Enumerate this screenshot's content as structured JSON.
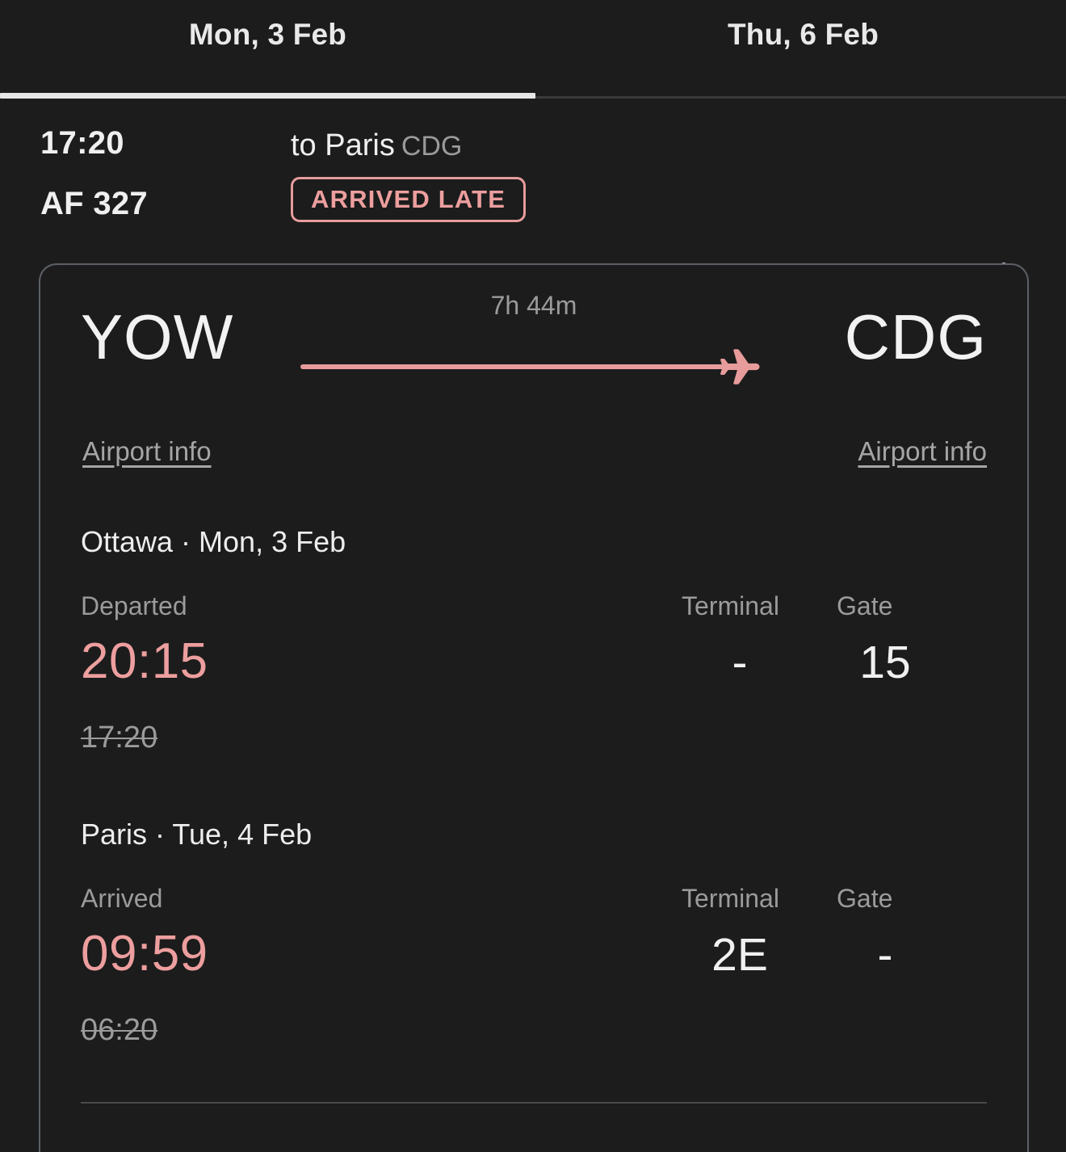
{
  "colors": {
    "background": "#1c1c1c",
    "accent_salmon": "#ed9e9e",
    "text_primary": "#f0f0f0",
    "text_muted": "#9b9b9b",
    "card_border": "#5c6066",
    "tab_indicator": "#e6e6e6"
  },
  "tabs": [
    {
      "label": "Mon, 3 Feb",
      "active": true
    },
    {
      "label": "Thu, 6 Feb",
      "active": false
    }
  ],
  "flight_header": {
    "scheduled_time": "17:20",
    "flight_number": "AF 327",
    "destination_prefix": "to Paris",
    "destination_code": "CDG",
    "status_badge": "ARRIVED LATE",
    "collapse_icon": "chevron-up-icon"
  },
  "route": {
    "origin_code": "YOW",
    "destination_code": "CDG",
    "duration": "7h 44m",
    "plane_icon": "airplane-icon",
    "origin_airport_info_label": "Airport info",
    "destination_airport_info_label": "Airport info"
  },
  "departure": {
    "title": "Ottawa · Mon, 3 Feb",
    "status_label": "Departed",
    "actual_time": "20:15",
    "scheduled_time": "17:20",
    "terminal_label": "Terminal",
    "terminal_value": "-",
    "gate_label": "Gate",
    "gate_value": "15"
  },
  "arrival": {
    "title": "Paris · Tue, 4 Feb",
    "status_label": "Arrived",
    "actual_time": "09:59",
    "scheduled_time": "06:20",
    "terminal_label": "Terminal",
    "terminal_value": "2E",
    "gate_label": "Gate",
    "gate_value": "-"
  }
}
